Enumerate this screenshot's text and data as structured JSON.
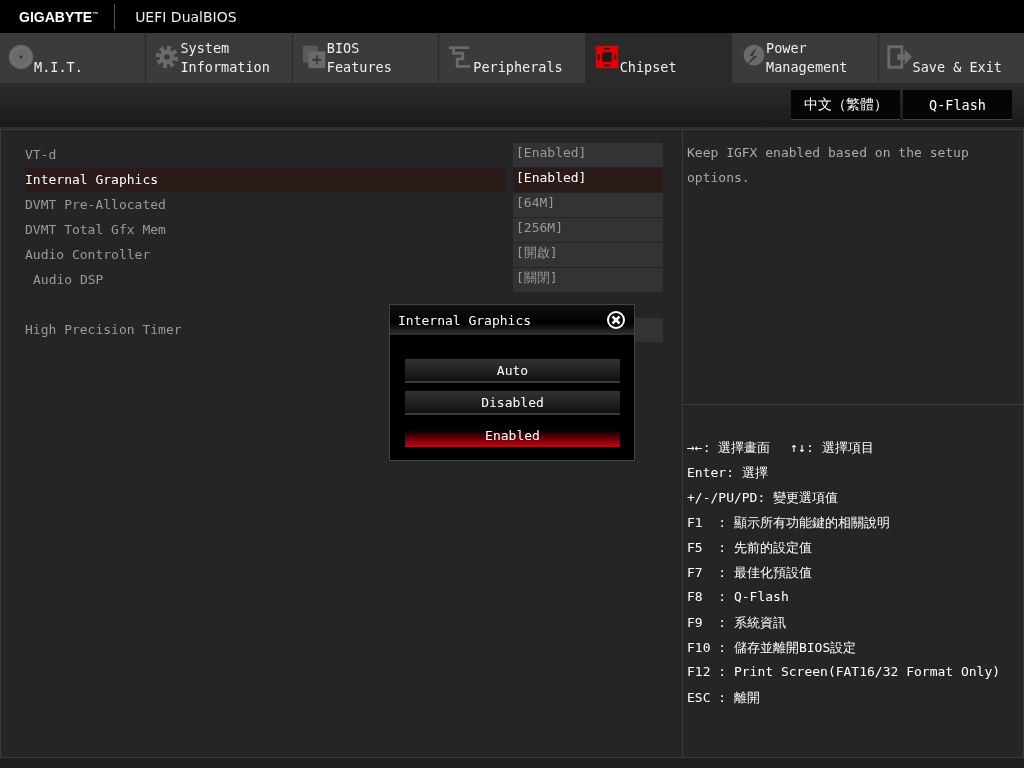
{
  "header": {
    "brand": "GIGABYTE",
    "tm": "™",
    "title": "UEFI DualBIOS"
  },
  "tabs": [
    {
      "kind": "disc",
      "lines": [
        "M.I.T."
      ],
      "selected": false
    },
    {
      "kind": "gear",
      "lines": [
        "System",
        "Information"
      ],
      "selected": false
    },
    {
      "kind": "board",
      "lines": [
        "BIOS",
        "Features"
      ],
      "selected": false
    },
    {
      "kind": "plug",
      "lines": [
        "Peripherals"
      ],
      "selected": false
    },
    {
      "kind": "chipset",
      "lines": [
        "Chipset"
      ],
      "selected": true
    },
    {
      "kind": "bolt",
      "lines": [
        "Power",
        "Management"
      ],
      "selected": false
    },
    {
      "kind": "exit",
      "lines": [
        "Save & Exit"
      ],
      "selected": false
    }
  ],
  "toolbar_buttons": [
    "中文（繁體）",
    "Q-Flash"
  ],
  "settings_groups": [
    [
      {
        "label": "VT-d",
        "value": "[Enabled]",
        "selected": false
      },
      {
        "label": "Internal Graphics",
        "value": "[Enabled]",
        "selected": true
      },
      {
        "label": "DVMT Pre-Allocated",
        "value": "[64M]",
        "selected": false
      },
      {
        "label": "DVMT Total Gfx Mem",
        "value": "[256M]",
        "selected": false
      },
      {
        "label": "Audio Controller",
        "value": "[開啟]",
        "selected": false,
        "children": [
          {
            "label": "Audio DSP",
            "value": "[關閉]",
            "selected": false
          }
        ]
      }
    ],
    [
      {
        "label": "High Precision Timer",
        "selected": false
      }
    ]
  ],
  "description": "Keep IGFX enabled based on the setup options.",
  "help": [
    [
      "→←: 選擇畫面",
      "↑↓: 選擇項目"
    ],
    [
      "Enter: 選擇"
    ],
    [
      "+/-/PU/PD: 變更選項值"
    ],
    [
      "F1  : 顯示所有功能鍵的相關說明"
    ],
    [
      "F5  : 先前的設定值"
    ],
    [
      "F7  : 最佳化預設值"
    ],
    [
      "F8  : Q-Flash"
    ],
    [
      "F9  : 系統資訊"
    ],
    [
      "F10 : 儲存並離開BIOS設定"
    ],
    [
      "F12 : Print Screen(FAT16/32 Format Only)"
    ],
    [
      "ESC : 離開"
    ]
  ],
  "popup": {
    "title": "Internal Graphics",
    "options": [
      {
        "label": "Auto",
        "selected": false
      },
      {
        "label": "Disabled",
        "selected": false
      },
      {
        "label": "Enabled",
        "selected": true
      }
    ]
  }
}
